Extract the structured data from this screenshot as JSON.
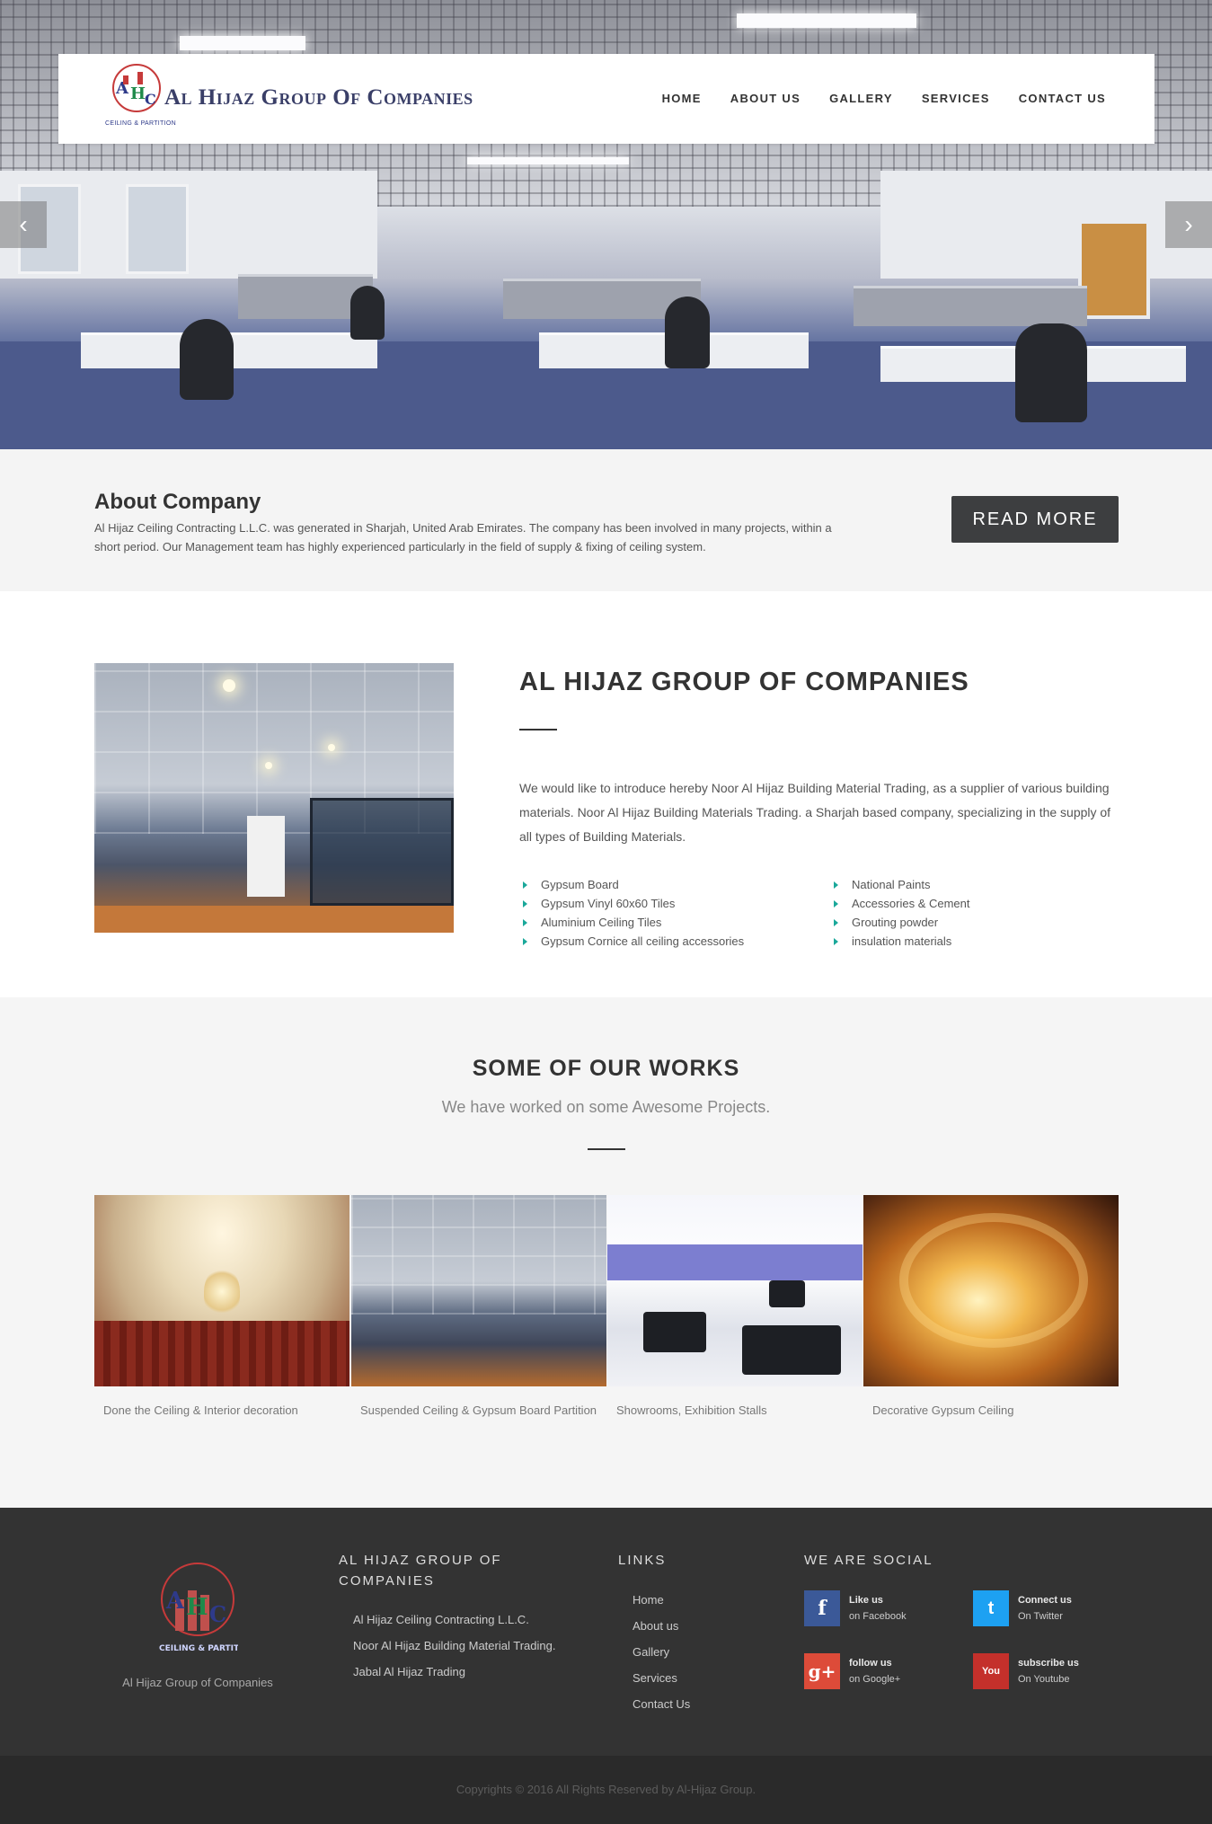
{
  "header": {
    "logo_title": "Al Hijaz Group Of Companies",
    "logo_letters": "AHC",
    "logo_caption": "CEILING & PARTITION",
    "nav": [
      {
        "label": "HOME"
      },
      {
        "label": "ABOUT US"
      },
      {
        "label": "GALLERY"
      },
      {
        "label": "SERVICES"
      },
      {
        "label": "CONTACT US"
      }
    ],
    "prev_arrow": "‹",
    "next_arrow": "›"
  },
  "about": {
    "title": "About Company",
    "text": "Al Hijaz Ceiling Contracting L.L.C. was generated in Sharjah, United Arab Emirates. The company has been involved in many projects, within a short period. Our Management team has highly experienced particularly in the field of supply & fixing of ceiling system.",
    "button": "READ MORE"
  },
  "company": {
    "title": "AL HIJAZ GROUP OF COMPANIES",
    "intro": "We would like to introduce hereby Noor Al Hijaz Building Material Trading, as a supplier of various building materials. Noor Al Hijaz Building Materials Trading. a Sharjah based company, specializing in the supply of all types of Building Materials.",
    "list_left": [
      "Gypsum Board",
      "Gypsum Vinyl 60x60 Tiles",
      "Aluminium Ceiling Tiles",
      "Gypsum Cornice all ceiling accessories"
    ],
    "list_right": [
      "National Paints",
      "Accessories & Cement",
      "Grouting powder",
      "insulation materials"
    ]
  },
  "works": {
    "title": "SOME OF OUR WORKS",
    "subtitle": "We have worked on some Awesome Projects.",
    "items": [
      {
        "caption": "Done the Ceiling & Interior decoration"
      },
      {
        "caption": "Suspended Ceiling & Gypsum Board Partition"
      },
      {
        "caption": "Showrooms, Exhibition Stalls"
      },
      {
        "caption": "Decorative Gypsum Ceiling"
      }
    ]
  },
  "footer": {
    "logo_caption": "Al Hijaz Group of Companies",
    "group_heading": "AL HIJAZ GROUP OF COMPANIES",
    "group_items": [
      "Al Hijaz Ceiling Contracting L.L.C.",
      "Noor Al Hijaz Building Material Trading.",
      "Jabal Al Hijaz Trading"
    ],
    "links_heading": "LINKS",
    "links": [
      "Home",
      "About us",
      "Gallery",
      "Services",
      "Contact Us"
    ],
    "social_heading": "WE ARE SOCIAL",
    "social": [
      {
        "title": "Like us",
        "sub": "on Facebook",
        "icon": "facebook-icon",
        "glyph": "f",
        "color": "#3b5998"
      },
      {
        "title": "Connect us",
        "sub": "On Twitter",
        "icon": "twitter-icon",
        "glyph": "t",
        "color": "#1da1f2"
      },
      {
        "title": "follow us",
        "sub": "on Google+",
        "icon": "google-plus-icon",
        "glyph": "g+",
        "color": "#dd4b39"
      },
      {
        "title": "subscribe us",
        "sub": "On Youtube",
        "icon": "youtube-icon",
        "glyph": "You",
        "color": "#c4302b"
      }
    ]
  },
  "copyright": "Copyrights © 2016 All Rights Reserved by Al-Hijaz Group."
}
